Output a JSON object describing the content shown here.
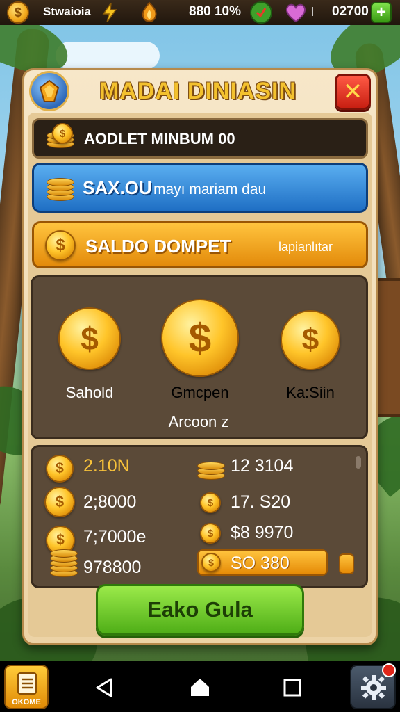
{
  "topbar": {
    "coin_symbol": "$",
    "player_name": "Stwaioia",
    "stats": "880 10%",
    "gems": "02700"
  },
  "dialog": {
    "title": "MADAI DINIASIN",
    "close_symbol": "✕",
    "row_dark_text": "AODLET MINBUM 00",
    "row_blue_title": "SAX.OU",
    "row_blue_sub": "mayı mariam dau",
    "row_orange_title": "SALDO DOMPET",
    "row_orange_sub": "lapianlıtar",
    "big_coins": [
      {
        "label": "Sahold",
        "color": "#ffffff"
      },
      {
        "label": "Gmcpen",
        "color": "#ffffff"
      },
      {
        "label": "Ka:Siin",
        "color": "#f5b623"
      }
    ],
    "big_coin_caption": "Arcoon z",
    "list_left": [
      "2.10N",
      "2;8000",
      "7;7000e",
      "978800"
    ],
    "list_right": [
      "12 3104",
      "17. S20",
      "$8 9970",
      "SO 380"
    ],
    "cta_label": "Eako Gula"
  },
  "navbar": {
    "home_label": "OKOME"
  },
  "colors": {
    "gold": "#f3c12e",
    "close_red": "#d8261a",
    "blue_row": "#2f82d6",
    "orange_row": "#f0a020",
    "cta_green": "#6cc72a"
  }
}
